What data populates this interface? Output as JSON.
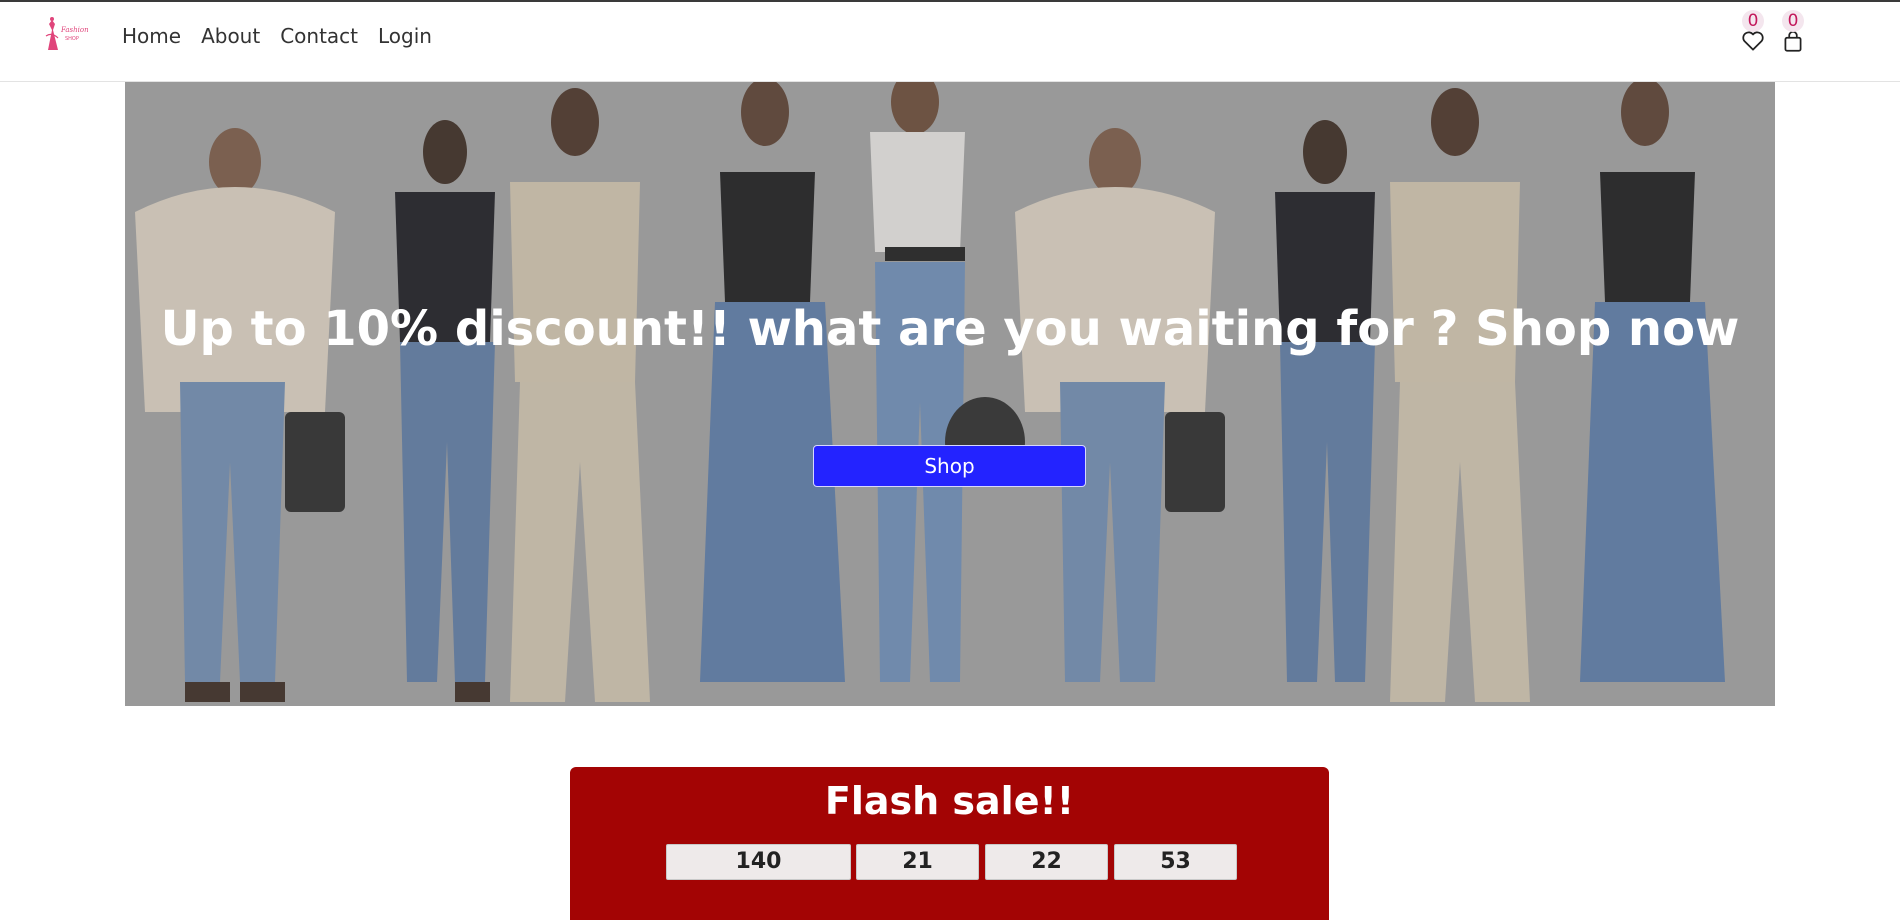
{
  "nav": {
    "logo_text": "Fashion shop",
    "links": [
      "Home",
      "About",
      "Contact",
      "Login"
    ],
    "wishlist_count": "0",
    "cart_count": "0",
    "icons": [
      "heart-icon",
      "bag-icon"
    ]
  },
  "hero": {
    "title": "Up to 10% discount!! what are you waiting for ? Shop now",
    "button_label": "Shop"
  },
  "flash_sale": {
    "title": "Flash sale!!",
    "timer": [
      "140",
      "21",
      "22",
      "53"
    ]
  },
  "colors": {
    "accent_pink": "#e0457b",
    "shop_button": "#2323ff",
    "flash_bg": "#a30404"
  }
}
